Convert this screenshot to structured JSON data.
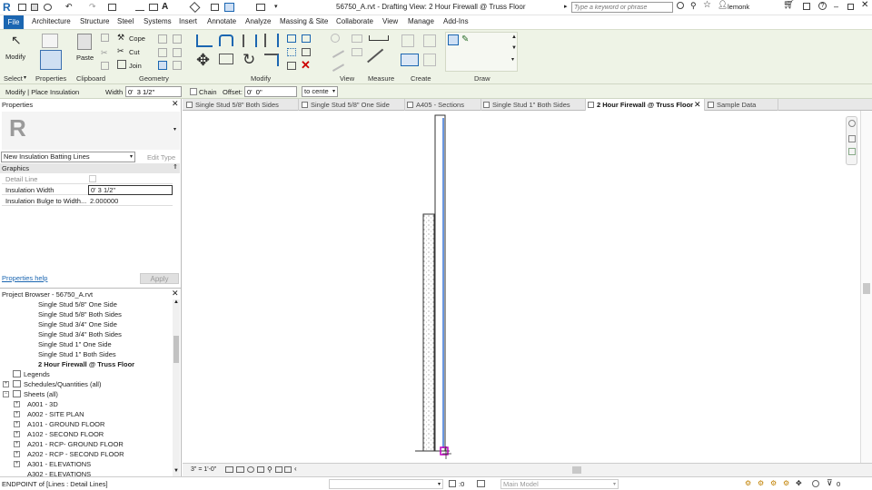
{
  "title_bar": {
    "document_title": "56750_A.rvt - Drafting View: 2 Hour Firewall @ Truss Floor",
    "search_placeholder": "Type a keyword or phrase",
    "username": "lemonk"
  },
  "menu": {
    "file": "File",
    "items": [
      "Architecture",
      "Structure",
      "Steel",
      "Systems",
      "Insert",
      "Annotate",
      "Analyze",
      "Massing & Site",
      "Collaborate",
      "View",
      "Manage",
      "Add-Ins"
    ]
  },
  "ribbon": {
    "modify_label": "Modify",
    "paste_label": "Paste",
    "cope_label": "Cope",
    "cut_label": "Cut",
    "join_label": "Join",
    "groups": {
      "select": "Select",
      "properties": "Properties",
      "clipboard": "Clipboard",
      "geometry": "Geometry",
      "modify": "Modify",
      "view": "View",
      "measure": "Measure",
      "create": "Create",
      "draw": "Draw"
    }
  },
  "options_bar": {
    "context": "Modify | Place Insulation",
    "width_label": "Width",
    "width_value": "0'  3 1/2\"",
    "chain_label": "Chain",
    "offset_label": "Offset:",
    "offset_value": "0'  0\"",
    "placement": "to cente"
  },
  "properties": {
    "header": "Properties",
    "type_name": "New Insulation Batting Lines",
    "edit_type": "Edit Type",
    "section": "Graphics",
    "rows": [
      {
        "label": "Detail Line",
        "value": ""
      },
      {
        "label": "Insulation Width",
        "value": "0'  3 1/2\""
      },
      {
        "label": "Insulation Bulge to Width...",
        "value": "2.000000"
      }
    ],
    "help_link": "Properties help",
    "apply": "Apply"
  },
  "project_browser": {
    "header": "Project Browser - 56750_A.rvt",
    "views": [
      "Single Stud 5/8\" One Side",
      "Single Stud 5/8\" Both Sides",
      "Single Stud 3/4\" One Side",
      "Single Stud 3/4\" Both Sides",
      "Single Stud 1\" One Side",
      "Single Stud 1\" Both Sides",
      "2 Hour Firewall @ Truss Floor"
    ],
    "nodes": {
      "legends": "Legends",
      "schedules": "Schedules/Quantities (all)",
      "sheets": "Sheets (all)"
    },
    "sheets": [
      "A001 - 3D",
      "A002 - SITE PLAN",
      "A101 - GROUND FLOOR",
      "A102 - SECOND FLOOR",
      "A201 - RCP- GROUND FLOOR",
      "A202 - RCP - SECOND FLOOR",
      "A301 - ELEVATIONS",
      "A302 - ELEVATIONS"
    ]
  },
  "tabs": [
    "Single Stud 5/8\" Both Sides",
    "Single Stud 5/8\" One Side",
    "A405 - Sections",
    "Single Stud 1\" Both Sides",
    "2 Hour Firewall @ Truss Floor",
    "Sample Data"
  ],
  "view_control": {
    "scale": "3\" = 1'-0\""
  },
  "status_bar": {
    "message": "ENDPOINT  of [Lines : Detail Lines]",
    "count": ":0",
    "model": "Main Model",
    "filter_count": "0"
  },
  "colors": {
    "file_blue": "#1b66b1",
    "ribbon_bg": "#eef3e6",
    "snap_marker": "#c000c0",
    "insulation_line": "#1a5fd0"
  }
}
